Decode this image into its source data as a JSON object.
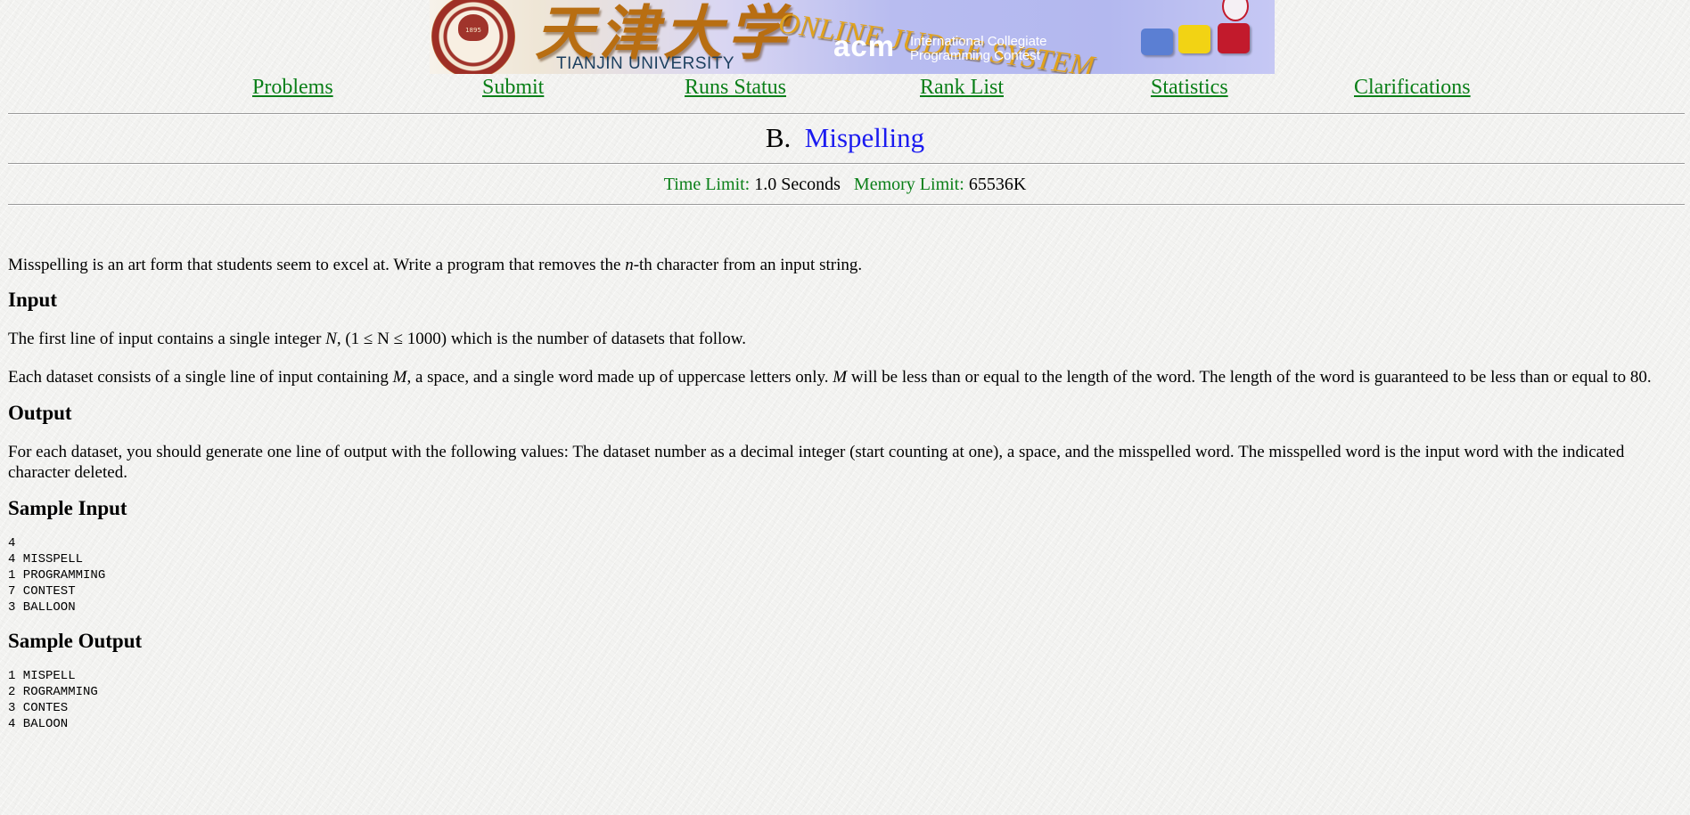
{
  "banner": {
    "seal_year": "1895",
    "university_cn": "天津大学",
    "university_en": "TIANJIN  UNIVERSITY",
    "system_title": "ONLINE JUDGE SYSTEM",
    "acm": "acm",
    "acm_line1": "International Collegiate",
    "acm_line2": "Programming Contest",
    "icons": [
      "cloud-icon",
      "lightbulb-icon",
      "balloon-icon"
    ]
  },
  "nav": {
    "items": [
      {
        "label": "Problems"
      },
      {
        "label": "Submit"
      },
      {
        "label": "Runs Status"
      },
      {
        "label": "Rank List"
      },
      {
        "label": "Statistics"
      },
      {
        "label": "Clarifications"
      }
    ]
  },
  "problem": {
    "number": "B.",
    "name": "Mispelling",
    "time_limit_label": "Time Limit:",
    "time_limit_value": "1.0 Seconds",
    "memory_limit_label": "Memory Limit:",
    "memory_limit_value": "65536K",
    "description": {
      "pre": "Misspelling is an art form that students seem to excel at. Write a program that removes the ",
      "var": "n",
      "post": "-th character from an input string."
    },
    "input_heading": "Input",
    "input_p1": {
      "pre": "The first line of input contains a single integer ",
      "var": "N",
      "post": ", (1 ≤ N ≤ 1000) which is the number of datasets that follow."
    },
    "input_p2": {
      "pre": "Each dataset consists of a single line of input containing ",
      "var1": "M",
      "mid": ", a space, and a single word made up of uppercase letters only. ",
      "var2": "M",
      "post": " will be less than or equal to the length of the word. The length of the word is guaranteed to be less than or equal to 80."
    },
    "output_heading": "Output",
    "output_p": "For each dataset, you should generate one line of output with the following values: The dataset number as a decimal integer (start counting at one), a space, and the misspelled word. The misspelled word is the input word with the indicated character deleted.",
    "sample_input_heading": "Sample Input",
    "sample_input": "4\n4 MISSPELL\n1 PROGRAMMING\n7 CONTEST\n3 BALLOON",
    "sample_output_heading": "Sample Output",
    "sample_output": "1 MISPELL\n2 ROGRAMMING\n3 CONTES\n4 BALOON"
  },
  "colors": {
    "link_green": "#0a7f18",
    "title_blue": "#1a1af0",
    "background": "#f3f3f1"
  }
}
